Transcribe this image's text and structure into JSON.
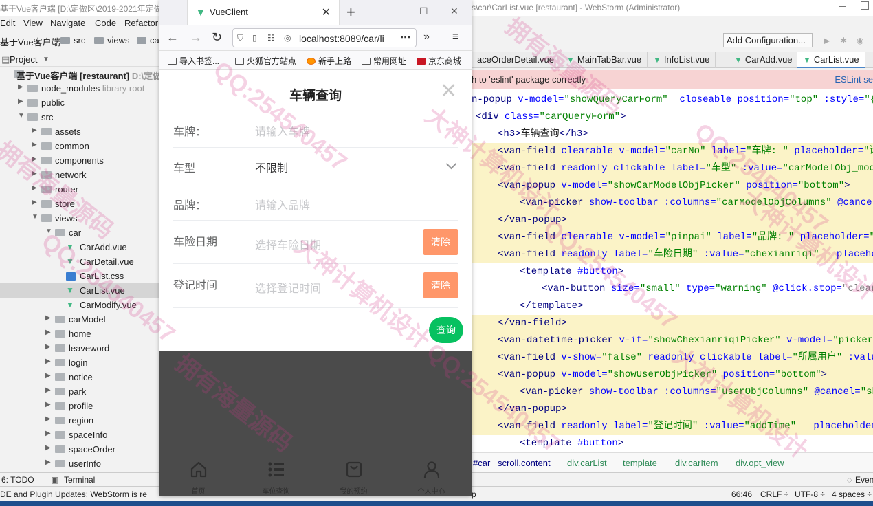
{
  "ide": {
    "title": "s\\car\\CarList.vue [restaurant] - WebStorm (Administrator)",
    "menu": [
      "Edit",
      "View",
      "Navigate",
      "Code",
      "Refactor"
    ],
    "menu_prefix": "基于Vue客户端 [D:\\定做区\\2019-2021年定做",
    "breadcrumb": [
      "基于Vue客户端",
      "src",
      "views",
      "ca"
    ],
    "add_configuration": "Add Configuration...",
    "project_label": "Project",
    "tree": [
      {
        "label": "基于Vue客户端 [restaurant]",
        "extra": "D:\\定做",
        "indent": 0,
        "kind": "root"
      },
      {
        "label": "node_modules",
        "extra": "library root",
        "indent": 1,
        "kind": "folder"
      },
      {
        "label": "public",
        "extra": "",
        "indent": 1,
        "kind": "folder"
      },
      {
        "label": "src",
        "extra": "",
        "indent": 1,
        "kind": "folder-open"
      },
      {
        "label": "assets",
        "extra": "",
        "indent": 2,
        "kind": "folder"
      },
      {
        "label": "common",
        "extra": "",
        "indent": 2,
        "kind": "folder"
      },
      {
        "label": "components",
        "extra": "",
        "indent": 2,
        "kind": "folder"
      },
      {
        "label": "network",
        "extra": "",
        "indent": 2,
        "kind": "folder"
      },
      {
        "label": "router",
        "extra": "",
        "indent": 2,
        "kind": "folder"
      },
      {
        "label": "store",
        "extra": "",
        "indent": 2,
        "kind": "folder"
      },
      {
        "label": "views",
        "extra": "",
        "indent": 2,
        "kind": "folder-open"
      },
      {
        "label": "car",
        "extra": "",
        "indent": 3,
        "kind": "folder-open"
      },
      {
        "label": "CarAdd.vue",
        "extra": "",
        "indent": 4,
        "kind": "vue"
      },
      {
        "label": "CarDetail.vue",
        "extra": "",
        "indent": 4,
        "kind": "vue"
      },
      {
        "label": "CarList.css",
        "extra": "",
        "indent": 4,
        "kind": "css"
      },
      {
        "label": "CarList.vue",
        "extra": "",
        "indent": 4,
        "kind": "vue",
        "selected": true
      },
      {
        "label": "CarModify.vue",
        "extra": "",
        "indent": 4,
        "kind": "vue"
      },
      {
        "label": "carModel",
        "extra": "",
        "indent": 3,
        "kind": "folder"
      },
      {
        "label": "home",
        "extra": "",
        "indent": 3,
        "kind": "folder"
      },
      {
        "label": "leaveword",
        "extra": "",
        "indent": 3,
        "kind": "folder"
      },
      {
        "label": "login",
        "extra": "",
        "indent": 3,
        "kind": "folder"
      },
      {
        "label": "notice",
        "extra": "",
        "indent": 3,
        "kind": "folder"
      },
      {
        "label": "park",
        "extra": "",
        "indent": 3,
        "kind": "folder"
      },
      {
        "label": "profile",
        "extra": "",
        "indent": 3,
        "kind": "folder"
      },
      {
        "label": "region",
        "extra": "",
        "indent": 3,
        "kind": "folder"
      },
      {
        "label": "spaceInfo",
        "extra": "",
        "indent": 3,
        "kind": "folder"
      },
      {
        "label": "spaceOrder",
        "extra": "",
        "indent": 3,
        "kind": "folder"
      },
      {
        "label": "userInfo",
        "extra": "",
        "indent": 3,
        "kind": "folder"
      }
    ],
    "file_tabs": [
      "aceOrderDetail.vue",
      "MainTabBar.vue",
      "InfoList.vue",
      "CarAdd.vue",
      "CarList.vue"
    ],
    "active_tab": "CarList.vue",
    "notice_text": "h to 'eslint' package correctly",
    "notice_link": "ESLint se",
    "code_lines": [
      {
        "indent": 0,
        "hl": false,
        "parts": [
          [
            "tg",
            "n-popup "
          ],
          [
            "an",
            "v-model="
          ],
          [
            "av",
            "\"showQueryCarForm\""
          ],
          [
            "an",
            "  closeable position="
          ],
          [
            "av",
            "\"top\""
          ],
          [
            "an",
            " :style="
          ],
          [
            "av",
            "\"{ he"
          ]
        ]
      },
      {
        "indent": 1,
        "hl": false,
        "parts": [
          [
            "tg",
            "<div "
          ],
          [
            "an",
            "class="
          ],
          [
            "av",
            "\"carQueryForm\""
          ],
          [
            "tg",
            ">"
          ]
        ]
      },
      {
        "indent": 2,
        "hl": false,
        "parts": [
          [
            "tg",
            "<h3>"
          ],
          [
            "txt",
            "车辆查询"
          ],
          [
            "tg",
            "</h3>"
          ]
        ]
      },
      {
        "indent": 2,
        "hl": true,
        "parts": [
          [
            "tg",
            "<van-field "
          ],
          [
            "an",
            "clearable v-model="
          ],
          [
            "av",
            "\"carNo\""
          ],
          [
            "an",
            " label="
          ],
          [
            "av",
            "\"车牌: \""
          ],
          [
            "an",
            " placeholder="
          ],
          [
            "av",
            "\"请输"
          ]
        ]
      },
      {
        "indent": 2,
        "hl": true,
        "parts": [
          [
            "tg",
            "<van-field "
          ],
          [
            "an",
            "readonly clickable label="
          ],
          [
            "av",
            "\"车型\""
          ],
          [
            "an",
            " :value="
          ],
          [
            "av",
            "\"carModelObj_model"
          ]
        ]
      },
      {
        "indent": 2,
        "hl": true,
        "parts": [
          [
            "tg",
            "<van-popup "
          ],
          [
            "an",
            "v-model="
          ],
          [
            "av",
            "\"showCarModelObjPicker\""
          ],
          [
            "an",
            " position="
          ],
          [
            "av",
            "\"bottom\""
          ],
          [
            "tg",
            ">"
          ]
        ]
      },
      {
        "indent": 3,
        "hl": true,
        "parts": [
          [
            "tg",
            "<van-picker "
          ],
          [
            "an",
            "show-toolbar :columns="
          ],
          [
            "av",
            "\"carModelObjColumns\""
          ],
          [
            "an",
            " @cancel="
          ],
          [
            "av",
            "\""
          ]
        ]
      },
      {
        "indent": 2,
        "hl": true,
        "parts": [
          [
            "tg",
            "</van-popup>"
          ]
        ]
      },
      {
        "indent": 2,
        "hl": true,
        "parts": [
          [
            "tg",
            "<van-field "
          ],
          [
            "an",
            "clearable v-model="
          ],
          [
            "av",
            "\"pinpai\""
          ],
          [
            "an",
            " label="
          ],
          [
            "av",
            "\"品牌: \""
          ],
          [
            "an",
            " placeholder="
          ],
          [
            "av",
            "\"请"
          ]
        ]
      },
      {
        "indent": 2,
        "hl": true,
        "parts": [
          [
            "tg",
            "<van-field "
          ],
          [
            "an",
            "readonly label="
          ],
          [
            "av",
            "\"车险日期\""
          ],
          [
            "an",
            " :value="
          ],
          [
            "av",
            "\"chexianriqi\""
          ],
          [
            "an",
            "   placehol"
          ]
        ]
      },
      {
        "indent": 3,
        "hl": false,
        "parts": [
          [
            "tg",
            "<template "
          ],
          [
            "an",
            "#button"
          ],
          [
            "tg",
            ">"
          ]
        ]
      },
      {
        "indent": 4,
        "hl": false,
        "parts": [
          [
            "tg",
            "<van-button "
          ],
          [
            "an",
            "size="
          ],
          [
            "av",
            "\"small\""
          ],
          [
            "an",
            " type="
          ],
          [
            "av",
            "\"warning\""
          ],
          [
            "an",
            " @click.stop="
          ],
          [
            "cm",
            "\"clearCh"
          ]
        ]
      },
      {
        "indent": 3,
        "hl": false,
        "parts": [
          [
            "tg",
            "</template>"
          ]
        ]
      },
      {
        "indent": 2,
        "hl": true,
        "parts": [
          [
            "tg",
            "</van-field>"
          ]
        ]
      },
      {
        "indent": 2,
        "hl": true,
        "parts": [
          [
            "tg",
            "<van-datetime-picker "
          ],
          [
            "an",
            "v-if="
          ],
          [
            "av",
            "\"showChexianriqiPicker\""
          ],
          [
            "an",
            " v-model="
          ],
          [
            "av",
            "\"picker_ch"
          ]
        ]
      },
      {
        "indent": 2,
        "hl": true,
        "parts": [
          [
            "tg",
            "<van-field "
          ],
          [
            "an",
            "v-show="
          ],
          [
            "av",
            "\"false\""
          ],
          [
            "an",
            " readonly clickable label="
          ],
          [
            "av",
            "\"所属用户\""
          ],
          [
            "an",
            " :value"
          ]
        ]
      },
      {
        "indent": 2,
        "hl": true,
        "parts": [
          [
            "tg",
            "<van-popup "
          ],
          [
            "an",
            "v-model="
          ],
          [
            "av",
            "\"showUserObjPicker\""
          ],
          [
            "an",
            " position="
          ],
          [
            "av",
            "\"bottom\""
          ],
          [
            "tg",
            ">"
          ]
        ]
      },
      {
        "indent": 3,
        "hl": true,
        "parts": [
          [
            "tg",
            "<van-picker "
          ],
          [
            "an",
            "show-toolbar :columns="
          ],
          [
            "av",
            "\"userObjColumns\""
          ],
          [
            "an",
            " @cancel="
          ],
          [
            "av",
            "\"show"
          ]
        ]
      },
      {
        "indent": 2,
        "hl": true,
        "parts": [
          [
            "tg",
            "</van-popup>"
          ]
        ]
      },
      {
        "indent": 2,
        "hl": true,
        "parts": [
          [
            "tg",
            "<van-field "
          ],
          [
            "an",
            "readonly label="
          ],
          [
            "av",
            "\"登记时间\""
          ],
          [
            "an",
            " :value="
          ],
          [
            "av",
            "\"addTime\""
          ],
          [
            "an",
            "   placeholder="
          ]
        ]
      },
      {
        "indent": 3,
        "hl": false,
        "parts": [
          [
            "tg",
            "<template "
          ],
          [
            "an",
            "#button"
          ],
          [
            "tg",
            ">"
          ]
        ]
      }
    ],
    "editor_breadcrumb": [
      "#car",
      "scroll.content",
      "div.carList",
      "template",
      "div.carItem",
      "div.opt_view"
    ],
    "toolwin_todo": "6: TODO",
    "toolwin_terminal": "Terminal",
    "toolwin_event": "Even",
    "status_msg": "DE and Plugin Updates: WebStorm is re",
    "status_msg2": "p",
    "status_pos": "66:46",
    "status_crlf": "CRLF ÷",
    "status_enc": "UTF-8 ÷",
    "status_indent": "4 spaces ÷"
  },
  "browser": {
    "tab_title": "VueClient",
    "url": "localhost:8089/car/li",
    "bookmarks": [
      "导入书签...",
      "火狐官方站点",
      "新手上路",
      "常用网址",
      "京东商城"
    ],
    "form": {
      "title": "车辆查询",
      "fields": [
        {
          "label": "车牌：",
          "value": "",
          "placeholder": "请输入车牌"
        },
        {
          "label": "车型",
          "value": "不限制",
          "placeholder": ""
        },
        {
          "label": "品牌：",
          "value": "",
          "placeholder": "请输入品牌"
        },
        {
          "label": "车险日期",
          "value": "",
          "placeholder": "选择车险日期"
        },
        {
          "label": "登记时间",
          "value": "",
          "placeholder": "选择登记时间"
        }
      ],
      "clear_label": "清除",
      "query_label": "查询"
    },
    "tabbar": [
      {
        "label": "首页",
        "icon": "home-icon"
      },
      {
        "label": "车位查询",
        "icon": "list-icon"
      },
      {
        "label": "我的预约",
        "icon": "bag-icon"
      },
      {
        "label": "个人中心",
        "icon": "user-icon"
      }
    ]
  },
  "watermark": {
    "text_qq": "QQ:254540457",
    "text_shop": "大神计算机设计",
    "text_src": "拥有海量源码",
    "color": "#d6398a"
  }
}
